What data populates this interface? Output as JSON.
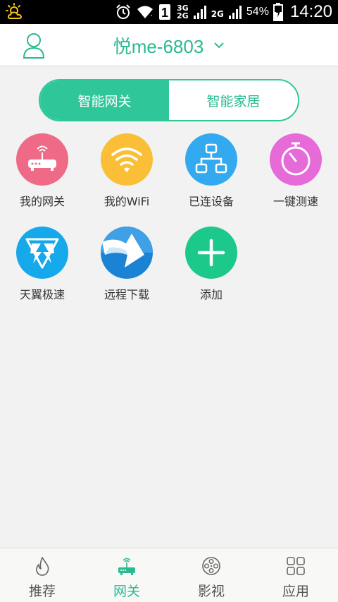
{
  "status_bar": {
    "weather_icon": "sun-cloud-icon",
    "alarm_icon": "alarm-icon",
    "wifi_icon": "wifi-icon",
    "sim_badge": "1",
    "network_top": "3G",
    "network_bottom": "2G",
    "network_2": "2G",
    "battery_pct": "54%",
    "time": "14:20"
  },
  "header": {
    "user_icon": "user-icon",
    "title": "悦me-6803",
    "dropdown_icon": "chevron-down-icon"
  },
  "segment": {
    "tabs": [
      {
        "label": "智能网关",
        "active": true
      },
      {
        "label": "智能家居",
        "active": false
      }
    ]
  },
  "grid": {
    "items": [
      {
        "label": "我的网关",
        "icon": "router-icon",
        "color": "#ef6a86"
      },
      {
        "label": "我的WiFi",
        "icon": "wifi-icon",
        "color": "#fbbf37"
      },
      {
        "label": "已连设备",
        "icon": "network-devices-icon",
        "color": "#33aaf0"
      },
      {
        "label": "一键测速",
        "icon": "speedometer-icon",
        "color": "#e66ad8"
      },
      {
        "label": "天翼极速",
        "icon": "tianyi-speed-icon",
        "color": "#15a8ea"
      },
      {
        "label": "远程下载",
        "icon": "remote-download-icon",
        "color": "#1b83d4"
      },
      {
        "label": "添加",
        "icon": "plus-icon",
        "color": "#1dc98a"
      }
    ]
  },
  "bottom_nav": {
    "items": [
      {
        "label": "推荐",
        "icon": "flame-icon",
        "active": false
      },
      {
        "label": "网关",
        "icon": "router-icon",
        "active": true
      },
      {
        "label": "影视",
        "icon": "film-reel-icon",
        "active": false
      },
      {
        "label": "应用",
        "icon": "apps-grid-icon",
        "active": false
      }
    ]
  },
  "colors": {
    "accent": "#2fc79a",
    "accent_text": "#2ab991"
  }
}
